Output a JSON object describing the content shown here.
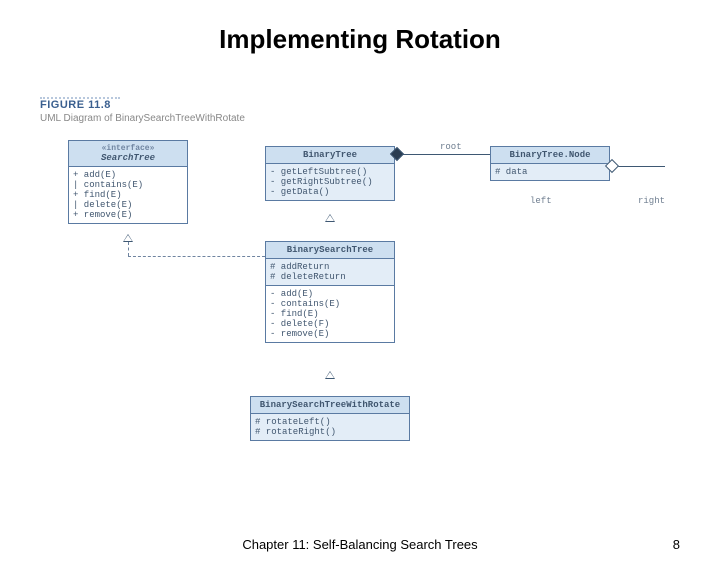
{
  "title": "Implementing Rotation",
  "figure": {
    "label": "FIGURE 11.8",
    "caption": "UML Diagram of BinarySearchTreeWithRotate"
  },
  "boxes": {
    "searchtree": {
      "stereotype": "«interface»",
      "name": "SearchTree",
      "ops": [
        "+ add(E)",
        "| contains(E)",
        "+ find(E)",
        "| delete(E)",
        "+ remove(E)"
      ]
    },
    "binarytree": {
      "name": "BinaryTree",
      "ops": [
        "- getLeftSubtree()",
        "- getRightSubtree()",
        "- getData()"
      ]
    },
    "node": {
      "name": "BinaryTree.Node",
      "attrs": [
        "# data"
      ]
    },
    "bst": {
      "name": "BinarySearchTree",
      "attrs": [
        "# addReturn",
        "# deleteReturn"
      ],
      "ops": [
        "- add(E)",
        "- contains(E)",
        "- find(E)",
        "- delete(F)",
        "- remove(E)"
      ]
    },
    "rotate": {
      "name": "BinarySearchTreeWithRotate",
      "attrs": [
        "# rotateLeft()",
        "# rotateRight()"
      ]
    }
  },
  "labels": {
    "root": "root",
    "left": "left",
    "right": "right"
  },
  "footer": {
    "chapter": "Chapter 11: Self-Balancing Search Trees",
    "page": "8"
  }
}
